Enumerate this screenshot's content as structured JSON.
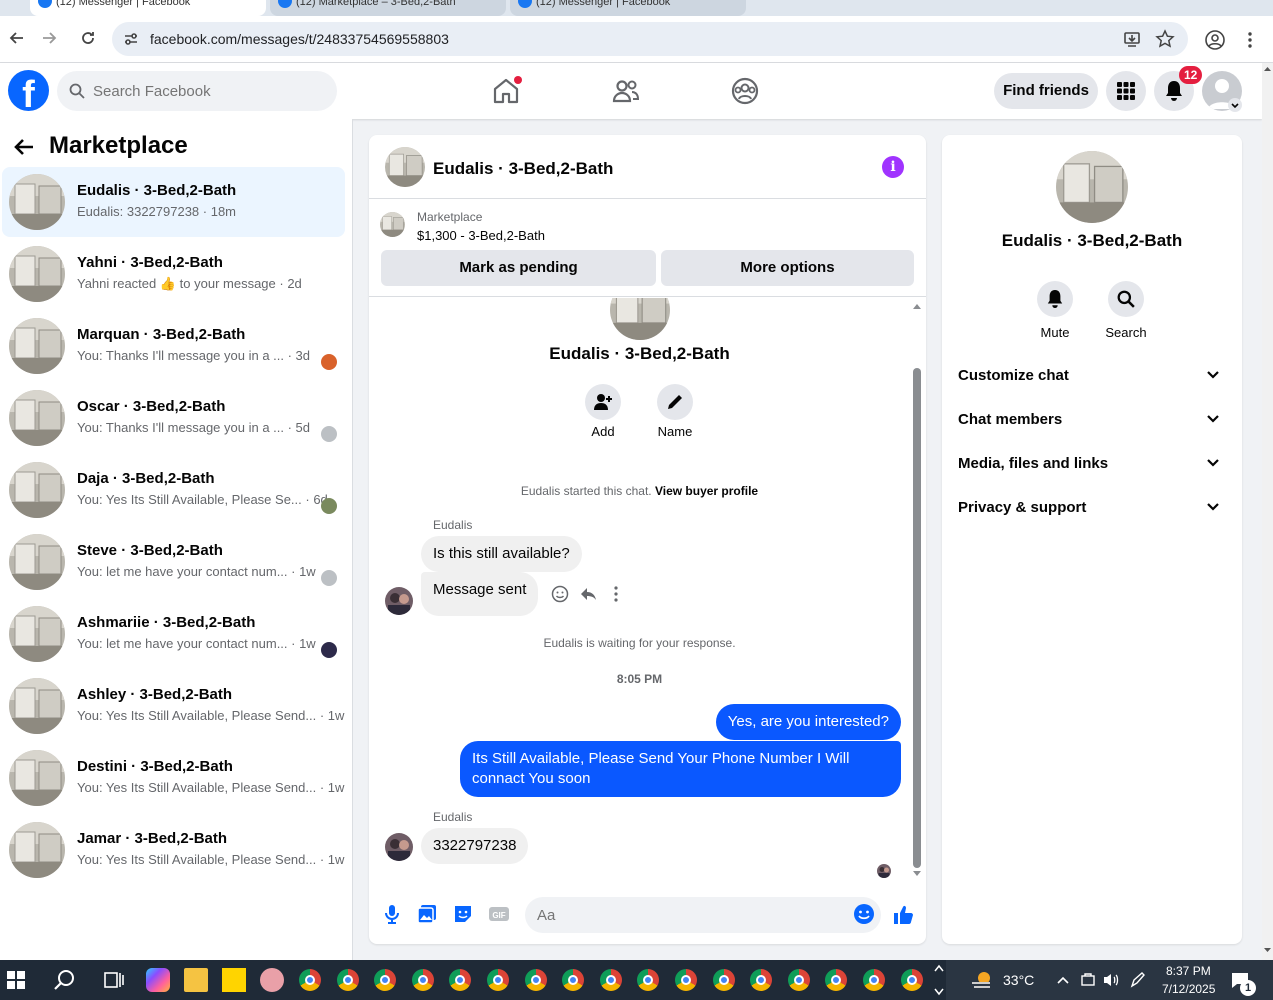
{
  "browser": {
    "tabs": [
      "(12) Messenger | Facebook",
      "(12) Marketplace – 3-Bed,2-Bath",
      "(12) Messenger | Facebook"
    ],
    "url": "facebook.com/messages/t/24833754569558803"
  },
  "fb_header": {
    "search_placeholder": "Search Facebook",
    "find_friends": "Find friends",
    "notifications_count": "12"
  },
  "sidebar": {
    "title": "Marketplace",
    "conversations": [
      {
        "name": "Eudalis · 3-Bed,2-Bath",
        "preview": "Eudalis: 3322797238 · 18m",
        "active": true
      },
      {
        "name": "Yahni · 3-Bed,2-Bath",
        "preview": "Yahni reacted 👍 to your message · 2d"
      },
      {
        "name": "Marquan · 3-Bed,2-Bath",
        "preview": "You: Thanks I'll message you in a ... · 3d"
      },
      {
        "name": "Oscar · 3-Bed,2-Bath",
        "preview": "You: Thanks I'll message you in a ... · 5d"
      },
      {
        "name": "Daja · 3-Bed,2-Bath",
        "preview": "You: Yes Its Still Available, Please Se... · 6d"
      },
      {
        "name": "Steve · 3-Bed,2-Bath",
        "preview": "You: let me have your contact num... · 1w"
      },
      {
        "name": "Ashmariie · 3-Bed,2-Bath",
        "preview": "You: let me have your contact num... · 1w"
      },
      {
        "name": "Ashley · 3-Bed,2-Bath",
        "preview": "You: Yes Its Still Available, Please Send... · 1w"
      },
      {
        "name": "Destini · 3-Bed,2-Bath",
        "preview": "You: Yes Its Still Available, Please Send... · 1w"
      },
      {
        "name": "Jamar · 3-Bed,2-Bath",
        "preview": "You: Yes Its Still Available, Please Send... · 1w"
      }
    ]
  },
  "chat": {
    "title": "Eudalis · 3-Bed,2-Bath",
    "marketplace_label": "Marketplace",
    "listing": "$1,300 - 3-Bed,2-Bath",
    "mark_pending": "Mark as pending",
    "more_options": "More options",
    "intro_name": "Eudalis · 3-Bed,2-Bath",
    "add_label": "Add",
    "name_label": "Name",
    "started_text": "Eudalis started this chat.",
    "view_buyer_profile": "View buyer profile",
    "sender_name": "Eudalis",
    "msg_1": "Is this still available?",
    "msg_2": "Message sent",
    "waiting_text": "Eudalis is waiting for your response.",
    "timestamp": "8:05 PM",
    "reply_1": "Yes, are you interested?",
    "reply_2": "Its Still Available, Please Send Your Phone Number I Will connact You soon",
    "sender_name_2": "Eudalis",
    "msg_3": "3322797238",
    "input_placeholder": "Aa"
  },
  "details": {
    "name": "Eudalis · 3-Bed,2-Bath",
    "mute": "Mute",
    "search": "Search",
    "sections": [
      "Customize chat",
      "Chat members",
      "Media, files and links",
      "Privacy & support"
    ]
  },
  "taskbar": {
    "temperature": "33°C",
    "time": "8:37 PM",
    "date": "7/12/2025",
    "notif_count": "1"
  },
  "colors": {
    "fb_blue": "#0866ff",
    "message_blue": "#0a58ff",
    "badge_red": "#e41e3f",
    "info_purple": "#a033ff"
  }
}
